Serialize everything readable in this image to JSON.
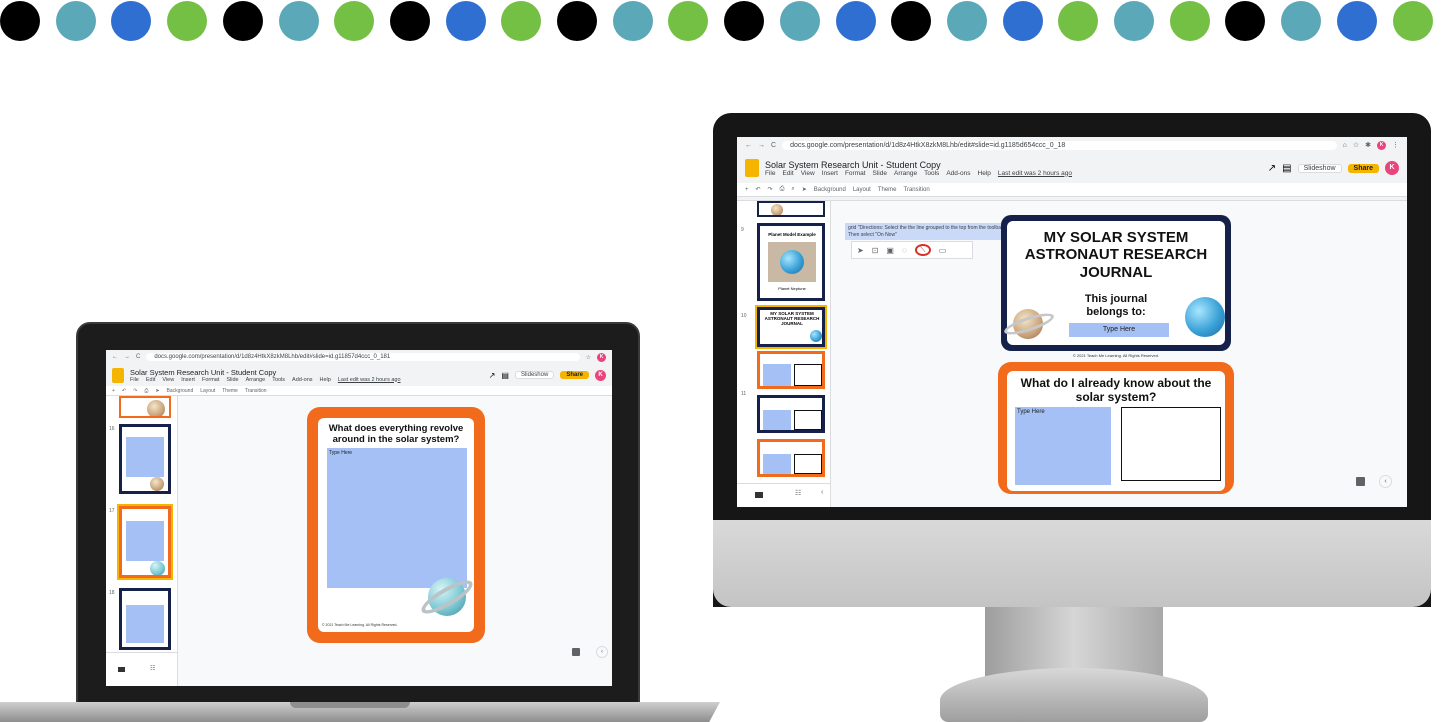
{
  "dots": {
    "colors": [
      "#000000",
      "#5aa8b8",
      "#2f6fd2",
      "#74c044",
      "#000000",
      "#5aa8b8",
      "#74c044",
      "#000000",
      "#2f6fd2",
      "#74c044",
      "#000000",
      "#5aa8b8",
      "#74c044",
      "#000000",
      "#5aa8b8",
      "#2f6fd2",
      "#000000",
      "#5aa8b8",
      "#2f6fd2",
      "#74c044",
      "#5aa8b8",
      "#74c044",
      "#000000",
      "#5aa8b8",
      "#2f6fd2",
      "#74c044"
    ]
  },
  "laptop": {
    "url": "docs.google.com/presentation/d/1d8z4HtkX8zkM8Lhb/edit#slide=id.g11857d4ccc_0_181",
    "doc_title": "Solar System Research Unit - Student Copy",
    "menu": [
      "File",
      "Edit",
      "View",
      "Insert",
      "Format",
      "Slide",
      "Arrange",
      "Tools",
      "Add-ons",
      "Help"
    ],
    "last_edit": "Last edit was 2 hours ago",
    "slideshow_label": "Slideshow",
    "share_label": "Share",
    "avatar_letter": "K",
    "toolbar": [
      "Background",
      "Layout",
      "Theme",
      "Transition"
    ],
    "slide_numbers": [
      "16",
      "17",
      "18"
    ],
    "slide_title": "What does everything revolve around in the solar system?",
    "type_here": "Type Here",
    "footer": "© 2021 Teach Me Learning. All Rights Reserved."
  },
  "monitor": {
    "url": "docs.google.com/presentation/d/1d8z4HtkX8zkM8Lhb/edit#slide=id.g1185d654ccc_0_18",
    "doc_title": "Solar System Research Unit - Student Copy",
    "menu": [
      "File",
      "Edit",
      "View",
      "Insert",
      "Format",
      "Slide",
      "Arrange",
      "Tools",
      "Add-ons",
      "Help"
    ],
    "last_edit": "Last edit was 2 hours ago",
    "slideshow_label": "Slideshow",
    "share_label": "Share",
    "avatar_letter": "K",
    "toolbar": [
      "Background",
      "Layout",
      "Theme",
      "Transition"
    ],
    "slide_numbers": [
      "9",
      "10",
      "11"
    ],
    "thumb_planet_title": "Planet Model Example",
    "thumb_planet_caption": "Planet Neptune",
    "tooltip": "grid \"Directions: Select the the line grouped to the top from the toolbar. Then select \"On Now\"",
    "cover_title": "MY SOLAR SYSTEM ASTRONAUT RESEARCH JOURNAL",
    "cover_belongs": "This journal belongs to:",
    "type_here": "Type Here",
    "copyright": "© 2021 Teach Me Learning. All Rights Reserved.",
    "question_title": "What do I already know about the solar system?"
  }
}
